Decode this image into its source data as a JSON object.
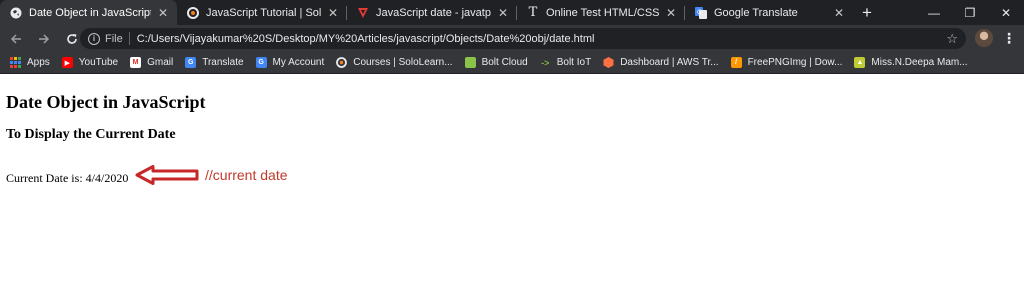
{
  "tabs": [
    {
      "title": "Date Object in JavaScript",
      "icon": "globe-icon",
      "active": true
    },
    {
      "title": "JavaScript Tutorial | SoloLearn:",
      "icon": "sololearn-icon",
      "active": false
    },
    {
      "title": "JavaScript date - javatpoint",
      "icon": "javatpoint-icon",
      "active": false
    },
    {
      "title": "Online Test HTML/CSS/JavaScri",
      "icon": "text-cursor-icon",
      "active": false
    },
    {
      "title": "Google Translate",
      "icon": "google-translate-icon",
      "active": false
    }
  ],
  "window_controls": {
    "minimize": "—",
    "restore": "❐",
    "close": "✕"
  },
  "toolbar": {
    "scheme_label": "File",
    "url": "C:/Users/Vijayakumar%20S/Desktop/MY%20Articles/javascript/Objects/Date%20obj/date.html"
  },
  "bookmarks": [
    {
      "label": "Apps",
      "icon": "apps-grid-icon"
    },
    {
      "label": "YouTube",
      "icon": "youtube-icon"
    },
    {
      "label": "Gmail",
      "icon": "gmail-icon"
    },
    {
      "label": "Translate",
      "icon": "translate-icon"
    },
    {
      "label": "My Account",
      "icon": "google-account-icon"
    },
    {
      "label": "Courses | SoloLearn...",
      "icon": "sololearn-icon"
    },
    {
      "label": "Bolt Cloud",
      "icon": "bolt-cloud-icon"
    },
    {
      "label": "Bolt IoT",
      "icon": "bolt-iot-icon"
    },
    {
      "label": "Dashboard | AWS Tr...",
      "icon": "aws-icon"
    },
    {
      "label": "FreePNGImg | Dow...",
      "icon": "freepng-icon"
    },
    {
      "label": "Miss.N.Deepa Mam...",
      "icon": "image-icon"
    }
  ],
  "page": {
    "heading": "Date Object in JavaScript",
    "subheading": "To Display the Current Date",
    "current_date_text": "Current Date is: 4/4/2020",
    "annotation": "//current date",
    "annotation_color": "#c0392b"
  },
  "colors": {
    "tabstrip": "#202124",
    "toolbar": "#35363a",
    "annotation_arrow": "#c62828"
  }
}
